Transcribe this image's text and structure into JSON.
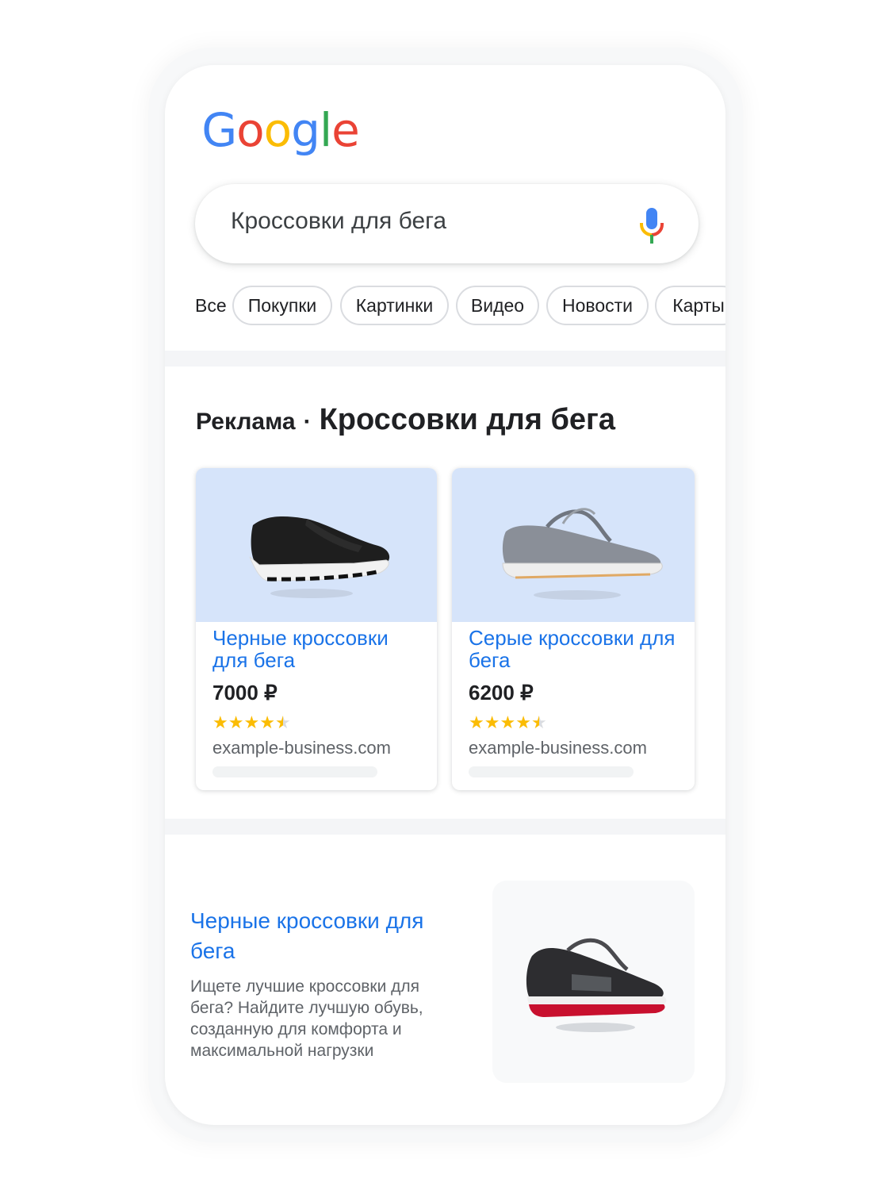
{
  "logo": [
    "G",
    "o",
    "o",
    "g",
    "l",
    "e"
  ],
  "logo_colors": [
    "#4285f4",
    "#ea4335",
    "#fbbc04",
    "#4285f4",
    "#34a853",
    "#ea4335"
  ],
  "search": {
    "query": "Кроссовки для бега"
  },
  "tabs": {
    "all": "Все",
    "items": [
      "Покупки",
      "Картинки",
      "Видео",
      "Новости",
      "Карты"
    ]
  },
  "ads": {
    "label": "Реклама",
    "separator": "·",
    "title": "Кроссовки для бега",
    "cards": [
      {
        "title": "Черные кроссовки для бега",
        "price": "7000 ₽",
        "rating": 4.5,
        "domain": "example-business.com"
      },
      {
        "title": "Серые кроссовки для бега",
        "price": "6200 ₽",
        "rating": 4.5,
        "domain": "example-business.com"
      }
    ]
  },
  "result": {
    "title": "Черные кроссовки для бега",
    "description": "Ищете лучшие кроссовки для бега? Найдите лучшую обувь, созданную для комфорта и максимальной нагрузки"
  },
  "colors": {
    "link": "#1a73e8",
    "star": "#fbbc04",
    "card_image_bg": "#d6e4fa"
  }
}
